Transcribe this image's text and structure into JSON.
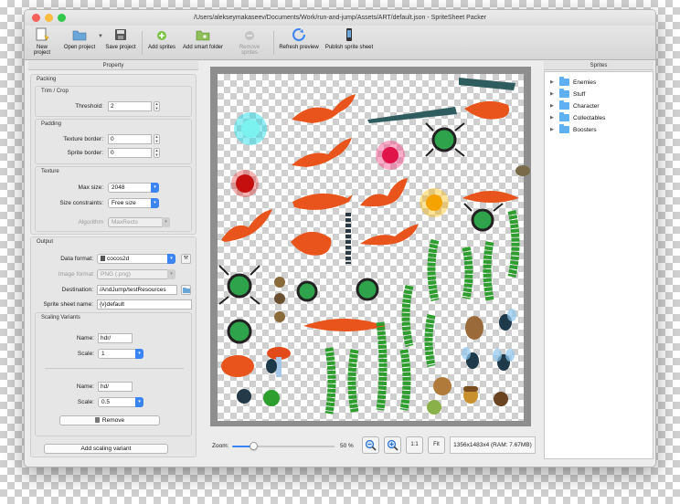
{
  "window": {
    "title": "/Users/alekseymakaseev/Documents/Work/run-and-jump/Assets/ART/default.json - SpriteSheet Packer",
    "traffic_colors": [
      "#fc605b",
      "#fdbc40",
      "#34c84a"
    ]
  },
  "toolbar": {
    "new_project": "New project",
    "open_project": "Open project",
    "save_project": "Save project",
    "add_sprites": "Add sprites",
    "add_smart_folder": "Add smart folder",
    "remove_sprites": "Remove sprites",
    "refresh_preview": "Refresh preview",
    "publish_sprite_sheet": "Publish sprite sheet"
  },
  "property": {
    "header": "Property",
    "packing": {
      "title": "Packing",
      "trim_crop": {
        "title": "Trim / Crop",
        "threshold_label": "Threshold:",
        "threshold_value": "2"
      },
      "padding": {
        "title": "Padding",
        "texture_border_label": "Texture border:",
        "texture_border_value": "0",
        "sprite_border_label": "Sprite border:",
        "sprite_border_value": "0"
      },
      "texture": {
        "title": "Texture",
        "max_size_label": "Max size:",
        "max_size_value": "2048",
        "size_constraints_label": "Size constraints:",
        "size_constraints_value": "Free size",
        "algorithm_label": "Algorithm",
        "algorithm_value": "MaxRects"
      }
    },
    "output": {
      "title": "Output",
      "data_format_label": "Data format:",
      "data_format_value": "cocos2d",
      "image_format_label": "Image format",
      "image_format_value": "PNG (.png)",
      "destination_label": "Destination:",
      "destination_value": "/AndJump/testResources",
      "sprite_sheet_name_label": "Sprite sheet name:",
      "sprite_sheet_name_value": "{v}default",
      "scaling_variants": {
        "title": "Scaling Variants",
        "variants": [
          {
            "name_label": "Name:",
            "name_value": "hdr/",
            "scale_label": "Scale:",
            "scale_value": "1"
          },
          {
            "name_label": "Name:",
            "name_value": "hd/",
            "scale_label": "Scale:",
            "scale_value": "0.5"
          }
        ],
        "remove_label": "Remove",
        "add_label": "Add scaling variant"
      }
    }
  },
  "preview": {
    "zoom_label": "Zoom:",
    "zoom_percent": "50 %",
    "zoom_level": 0.5,
    "zoom_1to1": "1:1",
    "zoom_fit": "Fit",
    "dimensions": "1356x1483x4 (RAM: 7.67MB)"
  },
  "sprites_panel": {
    "header": "Sprites",
    "folders": [
      "Enemies",
      "Stuff",
      "Character",
      "Collectables",
      "Boosters"
    ]
  }
}
